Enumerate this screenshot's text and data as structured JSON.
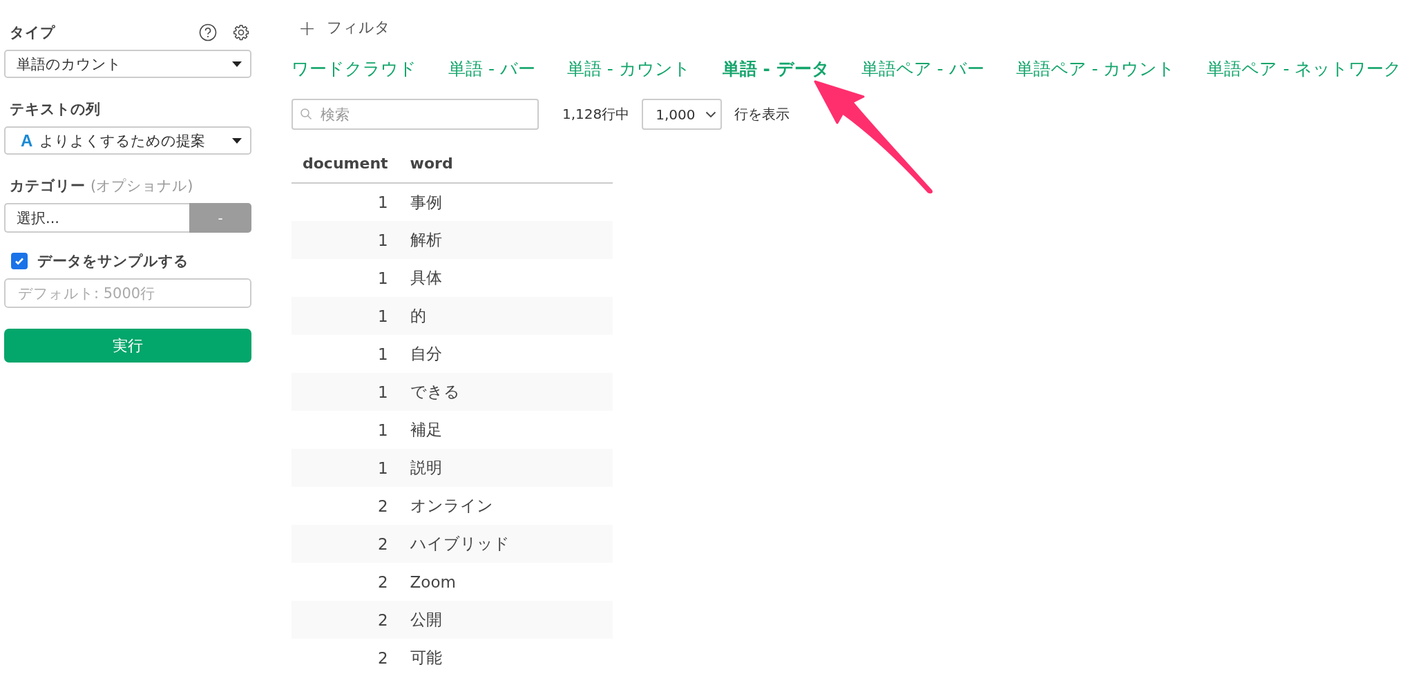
{
  "sidebar": {
    "type_label": "タイプ",
    "type_select": "単語のカウント",
    "text_column_label": "テキストの列",
    "text_column_icon": "A",
    "text_column_select": "よりよくするための提案",
    "category_label": "カテゴリー",
    "category_hint": "(オプショナル)",
    "category_select": "選択...",
    "category_button": "-",
    "sample": {
      "label": "データをサンプルする",
      "checked": true
    },
    "sample_input": {
      "placeholder": "デフォルト: 5000行"
    },
    "run_button": "実行"
  },
  "filter_button": {
    "icon": "+",
    "label": "フィルタ"
  },
  "tabs": [
    {
      "label": "ワードクラウド",
      "selected": false
    },
    {
      "label": "単語 - バー",
      "selected": false
    },
    {
      "label": "単語 - カウント",
      "selected": false
    },
    {
      "label": "単語 - データ",
      "selected": true
    },
    {
      "label": "単語ペア - バー",
      "selected": false
    },
    {
      "label": "単語ペア - カウント",
      "selected": false
    },
    {
      "label": "単語ペア - ネットワーク",
      "selected": false
    }
  ],
  "search": {
    "placeholder": "検索"
  },
  "row_count": "1,128行中",
  "rows_select": "1,000",
  "rows_suffix": "行を表示",
  "table": {
    "columns": [
      "document",
      "word"
    ],
    "rows": [
      [
        "1",
        "事例"
      ],
      [
        "1",
        "解析"
      ],
      [
        "1",
        "具体"
      ],
      [
        "1",
        "的"
      ],
      [
        "1",
        "自分"
      ],
      [
        "1",
        "できる"
      ],
      [
        "1",
        "補足"
      ],
      [
        "1",
        "説明"
      ],
      [
        "2",
        "オンライン"
      ],
      [
        "2",
        "ハイブリッド"
      ],
      [
        "2",
        "Zoom"
      ],
      [
        "2",
        "公開"
      ],
      [
        "2",
        "可能"
      ]
    ]
  }
}
